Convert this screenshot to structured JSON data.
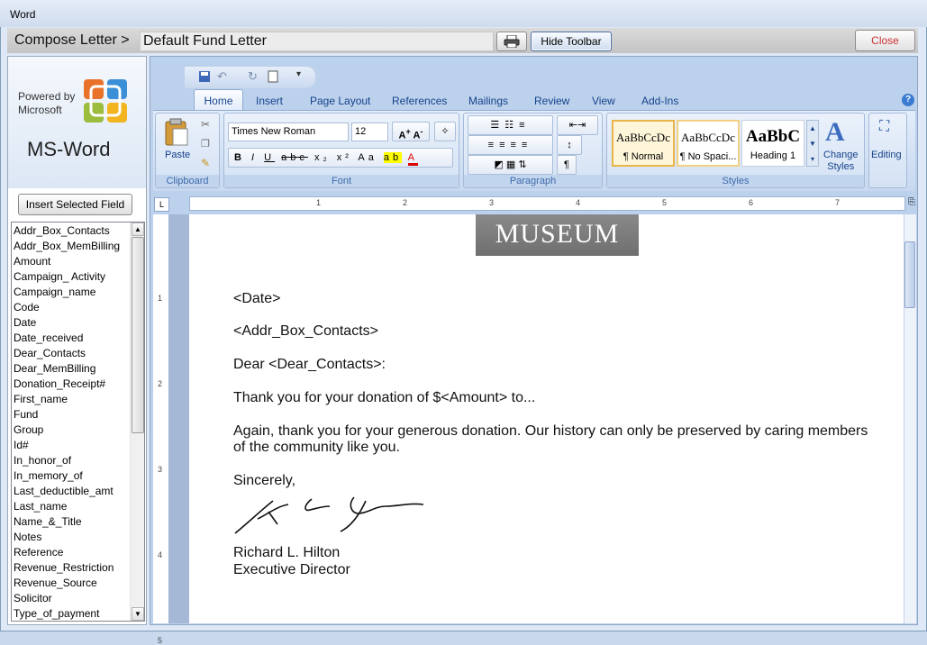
{
  "window": {
    "title": "Word"
  },
  "compose": {
    "label": "Compose Letter >",
    "document_name": "Default Fund Letter",
    "hide_toolbar_label": "Hide Toolbar",
    "close_label": "Close"
  },
  "brand": {
    "powered_by_line1": "Powered by",
    "powered_by_line2": "Microsoft",
    "product": "MS-Word"
  },
  "insert_field_label": "Insert Selected Field",
  "fields": [
    "Addr_Box_Contacts",
    "Addr_Box_MemBilling",
    "Amount",
    "Campaign_ Activity",
    "Campaign_name",
    "Code",
    "Date",
    "Date_received",
    "Dear_Contacts",
    "Dear_MemBilling",
    "Donation_Receipt#",
    "First_name",
    "Fund",
    "Group",
    "Id#",
    "In_honor_of",
    "In_memory_of",
    "Last_deductible_amt",
    "Last_name",
    "Name_&_Title",
    "Notes",
    "Reference",
    "Revenue_Restriction",
    "Revenue_Source",
    "Solicitor",
    "Type_of_payment"
  ],
  "ribbon": {
    "tabs": [
      "Home",
      "Insert",
      "Page Layout",
      "References",
      "Mailings",
      "Review",
      "View",
      "Add-Ins"
    ],
    "groups": {
      "clipboard": "Clipboard",
      "font": "Font",
      "paragraph": "Paragraph",
      "styles": "Styles"
    },
    "paste_label": "Paste",
    "font_name": "Times New Roman",
    "font_size": "12",
    "styles": [
      {
        "sample": "AaBbCcDc",
        "name": "¶ Normal"
      },
      {
        "sample": "AaBbCcDc",
        "name": "¶ No Spaci..."
      },
      {
        "sample": "AaBbC",
        "name": "Heading 1"
      }
    ],
    "change_styles_line1": "Change",
    "change_styles_line2": "Styles",
    "editing_label": "Editing"
  },
  "ruler_numbers": [
    "1",
    "2",
    "3",
    "4",
    "5",
    "6",
    "7"
  ],
  "vruler_numbers": [
    "1",
    "2",
    "3",
    "4",
    "5"
  ],
  "letter": {
    "logo_text": "MUSEUM",
    "date": "<Date>",
    "address": "<Addr_Box_Contacts>",
    "salutation": "Dear <Dear_Contacts>:",
    "para1": "Thank you for your donation of $<Amount> to...",
    "para2_line1": "Again, thank you for your generous donation.  Our history can only be preserved by caring members",
    "para2_line2": "of the community like you.",
    "closing": "Sincerely,",
    "signer_name": "Richard L. Hilton",
    "signer_title": "Executive Director"
  },
  "colors": {
    "accent": "#15428b",
    "close_text": "#cc3333",
    "ribbon_bg": "#d4e2f4"
  }
}
